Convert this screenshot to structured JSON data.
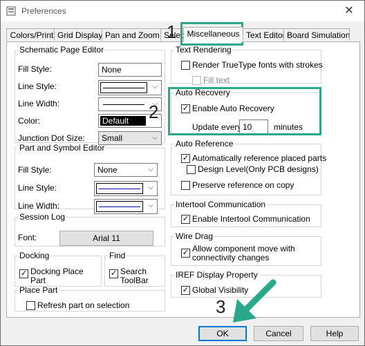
{
  "window": {
    "title": "Preferences",
    "close": "✕"
  },
  "tabs": [
    "Colors/Print",
    "Grid Display",
    "Pan and Zoom",
    "Select",
    "Miscellaneous",
    "Text Editor",
    "Board Simulation"
  ],
  "schematic": {
    "legend": "Schematic Page Editor",
    "fill_style_label": "Fill Style:",
    "fill_style_value": "None",
    "line_style_label": "Line Style:",
    "line_width_label": "Line Width:",
    "color_label": "Color:",
    "color_value": "Default",
    "junction_label": "Junction Dot Size:",
    "junction_value": "Small"
  },
  "part_symbol": {
    "legend": "Part and Symbol Editor",
    "fill_style_label": "Fill Style:",
    "fill_style_value": "None",
    "line_style_label": "Line Style:",
    "line_width_label": "Line Width:"
  },
  "session_log": {
    "legend": "Session Log",
    "font_label": "Font:",
    "font_value": "Arial 11"
  },
  "docking": {
    "legend": "Docking",
    "option": "Docking Place Part",
    "checked": true
  },
  "find": {
    "legend": "Find",
    "option": "Search ToolBar",
    "checked": true
  },
  "place_part": {
    "legend": "Place Part",
    "option": "Refresh part on selection",
    "checked": false
  },
  "text_rendering": {
    "legend": "Text Rendering",
    "truetype": "Render TrueType fonts with strokes",
    "truetype_checked": false,
    "fill_text": "Fill text",
    "fill_text_checked": false
  },
  "auto_recovery": {
    "legend": "Auto Recovery",
    "enable": "Enable Auto Recovery",
    "enable_checked": true,
    "update_label": "Update every",
    "update_value": "10",
    "update_unit": "minutes"
  },
  "auto_reference": {
    "legend": "Auto Reference",
    "auto_ref": "Automatically reference placed parts",
    "auto_ref_checked": true,
    "design_level": "Design Level(Only PCB designs)",
    "design_level_checked": false,
    "preserve": "Preserve reference on copy",
    "preserve_checked": false
  },
  "intertool": {
    "legend": "Intertool Communication",
    "enable": "Enable Intertool Communication",
    "checked": true
  },
  "wire_drag": {
    "legend": "Wire Drag",
    "option": "Allow component move with connectivity changes",
    "checked": true
  },
  "iref": {
    "legend": "IREF Display Property",
    "option": "Global Visibility",
    "checked": true
  },
  "buttons": {
    "ok": "OK",
    "cancel": "Cancel",
    "help": "Help"
  },
  "annotations": [
    "1",
    "2",
    "3"
  ],
  "colors": {
    "highlight": "#2aa88a",
    "ok_border": "#0078d7"
  }
}
